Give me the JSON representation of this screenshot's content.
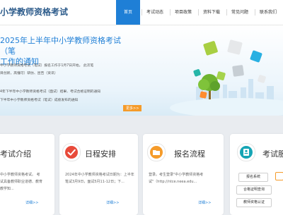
{
  "header": {
    "site_title": "小学教师资格考试",
    "nav": [
      "首页",
      "考试动态",
      "项目政策",
      "资料下载",
      "常见问题",
      "联系我们"
    ]
  },
  "hero": {
    "title_line1": "2025年上半年中小学教师资格考试（笔",
    "title_line2": "工作的通知",
    "lines": [
      "中小学教师资格考试（笔试）报名工作于1月7日开始。 此次笔",
      "目创新，高懂可）研仿、昆告（资讯）",
      "4年下半年中小学教师资格考试（面试）结果、考试合格证明的通知",
      "下半年中小学教师资格考试（笔试）成绩发布的通知"
    ],
    "more_label": "更多>>"
  },
  "cards": {
    "intro": {
      "title": "考试介绍",
      "text": "中小学教师资格考试。 考试具备教师职业道德、教育教学知...",
      "link": "详细>>"
    },
    "schedule": {
      "title": "日程安排",
      "text": "2024年中小学教师资格考试日期为：上半年笔试3月9日，面试5月11-12日；下...",
      "link": "详细>>"
    },
    "process": {
      "title": "报名流程",
      "text": "登录。考生登录\"中小学教师资格考试\"（http://ntce.neea.edu...",
      "link": "详细>>"
    },
    "service": {
      "title": "考试服",
      "buttons": [
        "报名系统",
        "合格证明查询",
        "教师资格认证"
      ]
    }
  },
  "colors": {
    "accent": "#1f7fd6",
    "orange": "#f59b2a"
  }
}
